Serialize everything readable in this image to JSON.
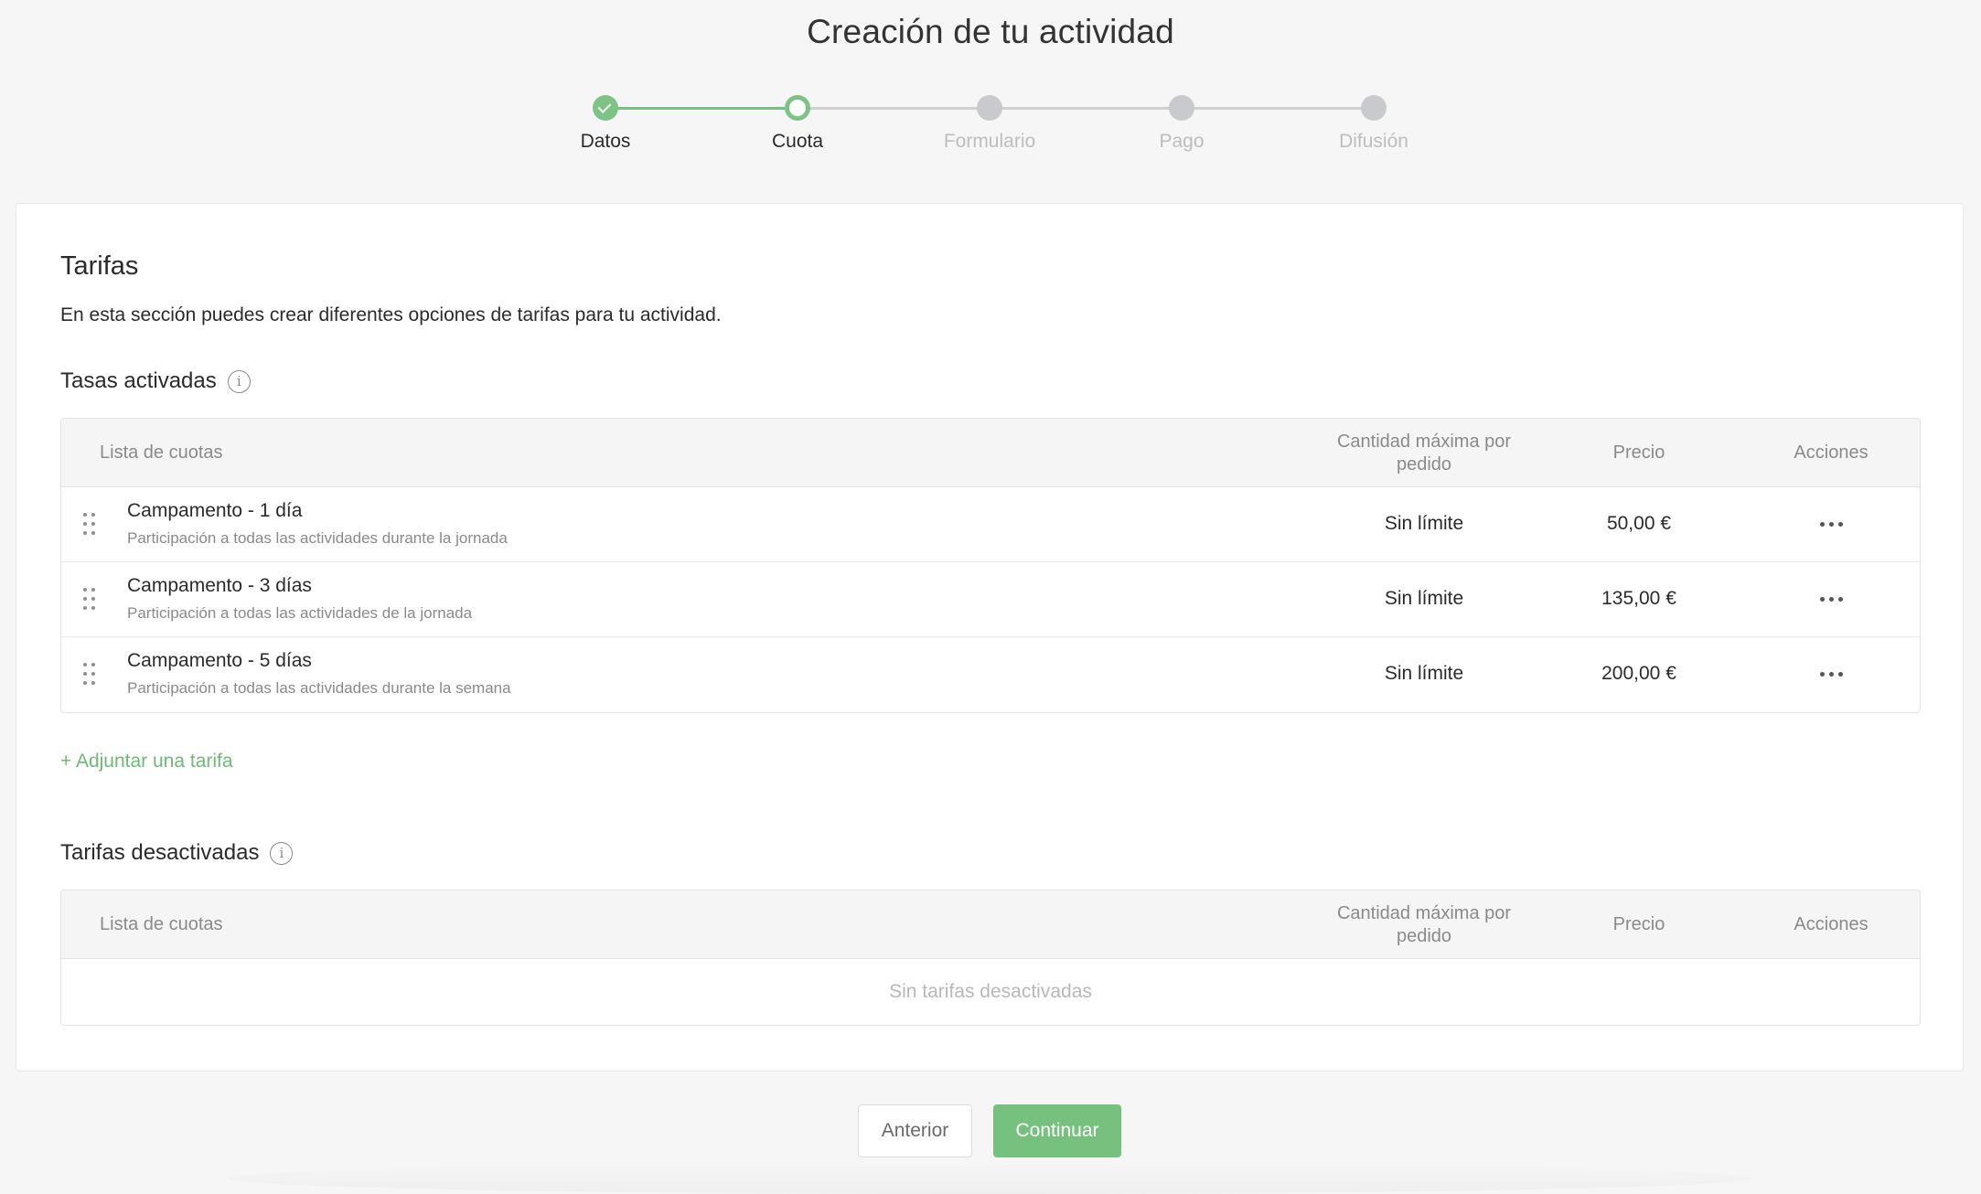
{
  "page": {
    "title": "Creación de tu actividad"
  },
  "stepper": {
    "steps": [
      {
        "label": "Datos",
        "state": "done"
      },
      {
        "label": "Cuota",
        "state": "current"
      },
      {
        "label": "Formulario",
        "state": "pending"
      },
      {
        "label": "Pago",
        "state": "pending"
      },
      {
        "label": "Difusión",
        "state": "pending"
      }
    ]
  },
  "tarifas": {
    "title": "Tarifas",
    "description": "En esta sección puedes crear diferentes opciones de tarifas para tu actividad."
  },
  "activas": {
    "title": "Tasas activadas",
    "headers": {
      "list": "Lista de cuotas",
      "qty": "Cantidad máxima por pedido",
      "price": "Precio",
      "actions": "Acciones"
    },
    "rows": [
      {
        "name": "Campamento - 1 día",
        "desc": "Participación a todas las actividades durante la jornada",
        "qty": "Sin límite",
        "price": "50,00 €"
      },
      {
        "name": "Campamento - 3 días",
        "desc": "Participación a todas las actividades de la jornada",
        "qty": "Sin límite",
        "price": "135,00 €"
      },
      {
        "name": "Campamento - 5 días",
        "desc": "Participación a todas las actividades durante la semana",
        "qty": "Sin límite",
        "price": "200,00 €"
      }
    ],
    "add_link": "+ Adjuntar una tarifa"
  },
  "desactivadas": {
    "title": "Tarifas desactivadas",
    "headers": {
      "list": "Lista de cuotas",
      "qty": "Cantidad máxima por pedido",
      "price": "Precio",
      "actions": "Acciones"
    },
    "empty": "Sin tarifas desactivadas"
  },
  "buttons": {
    "prev": "Anterior",
    "next": "Continuar"
  },
  "colors": {
    "accent": "#77c17f",
    "pending": "#c8cacd"
  },
  "icons": {
    "info": "info-icon",
    "drag": "drag-handle-icon",
    "more": "more-horizontal-icon"
  }
}
